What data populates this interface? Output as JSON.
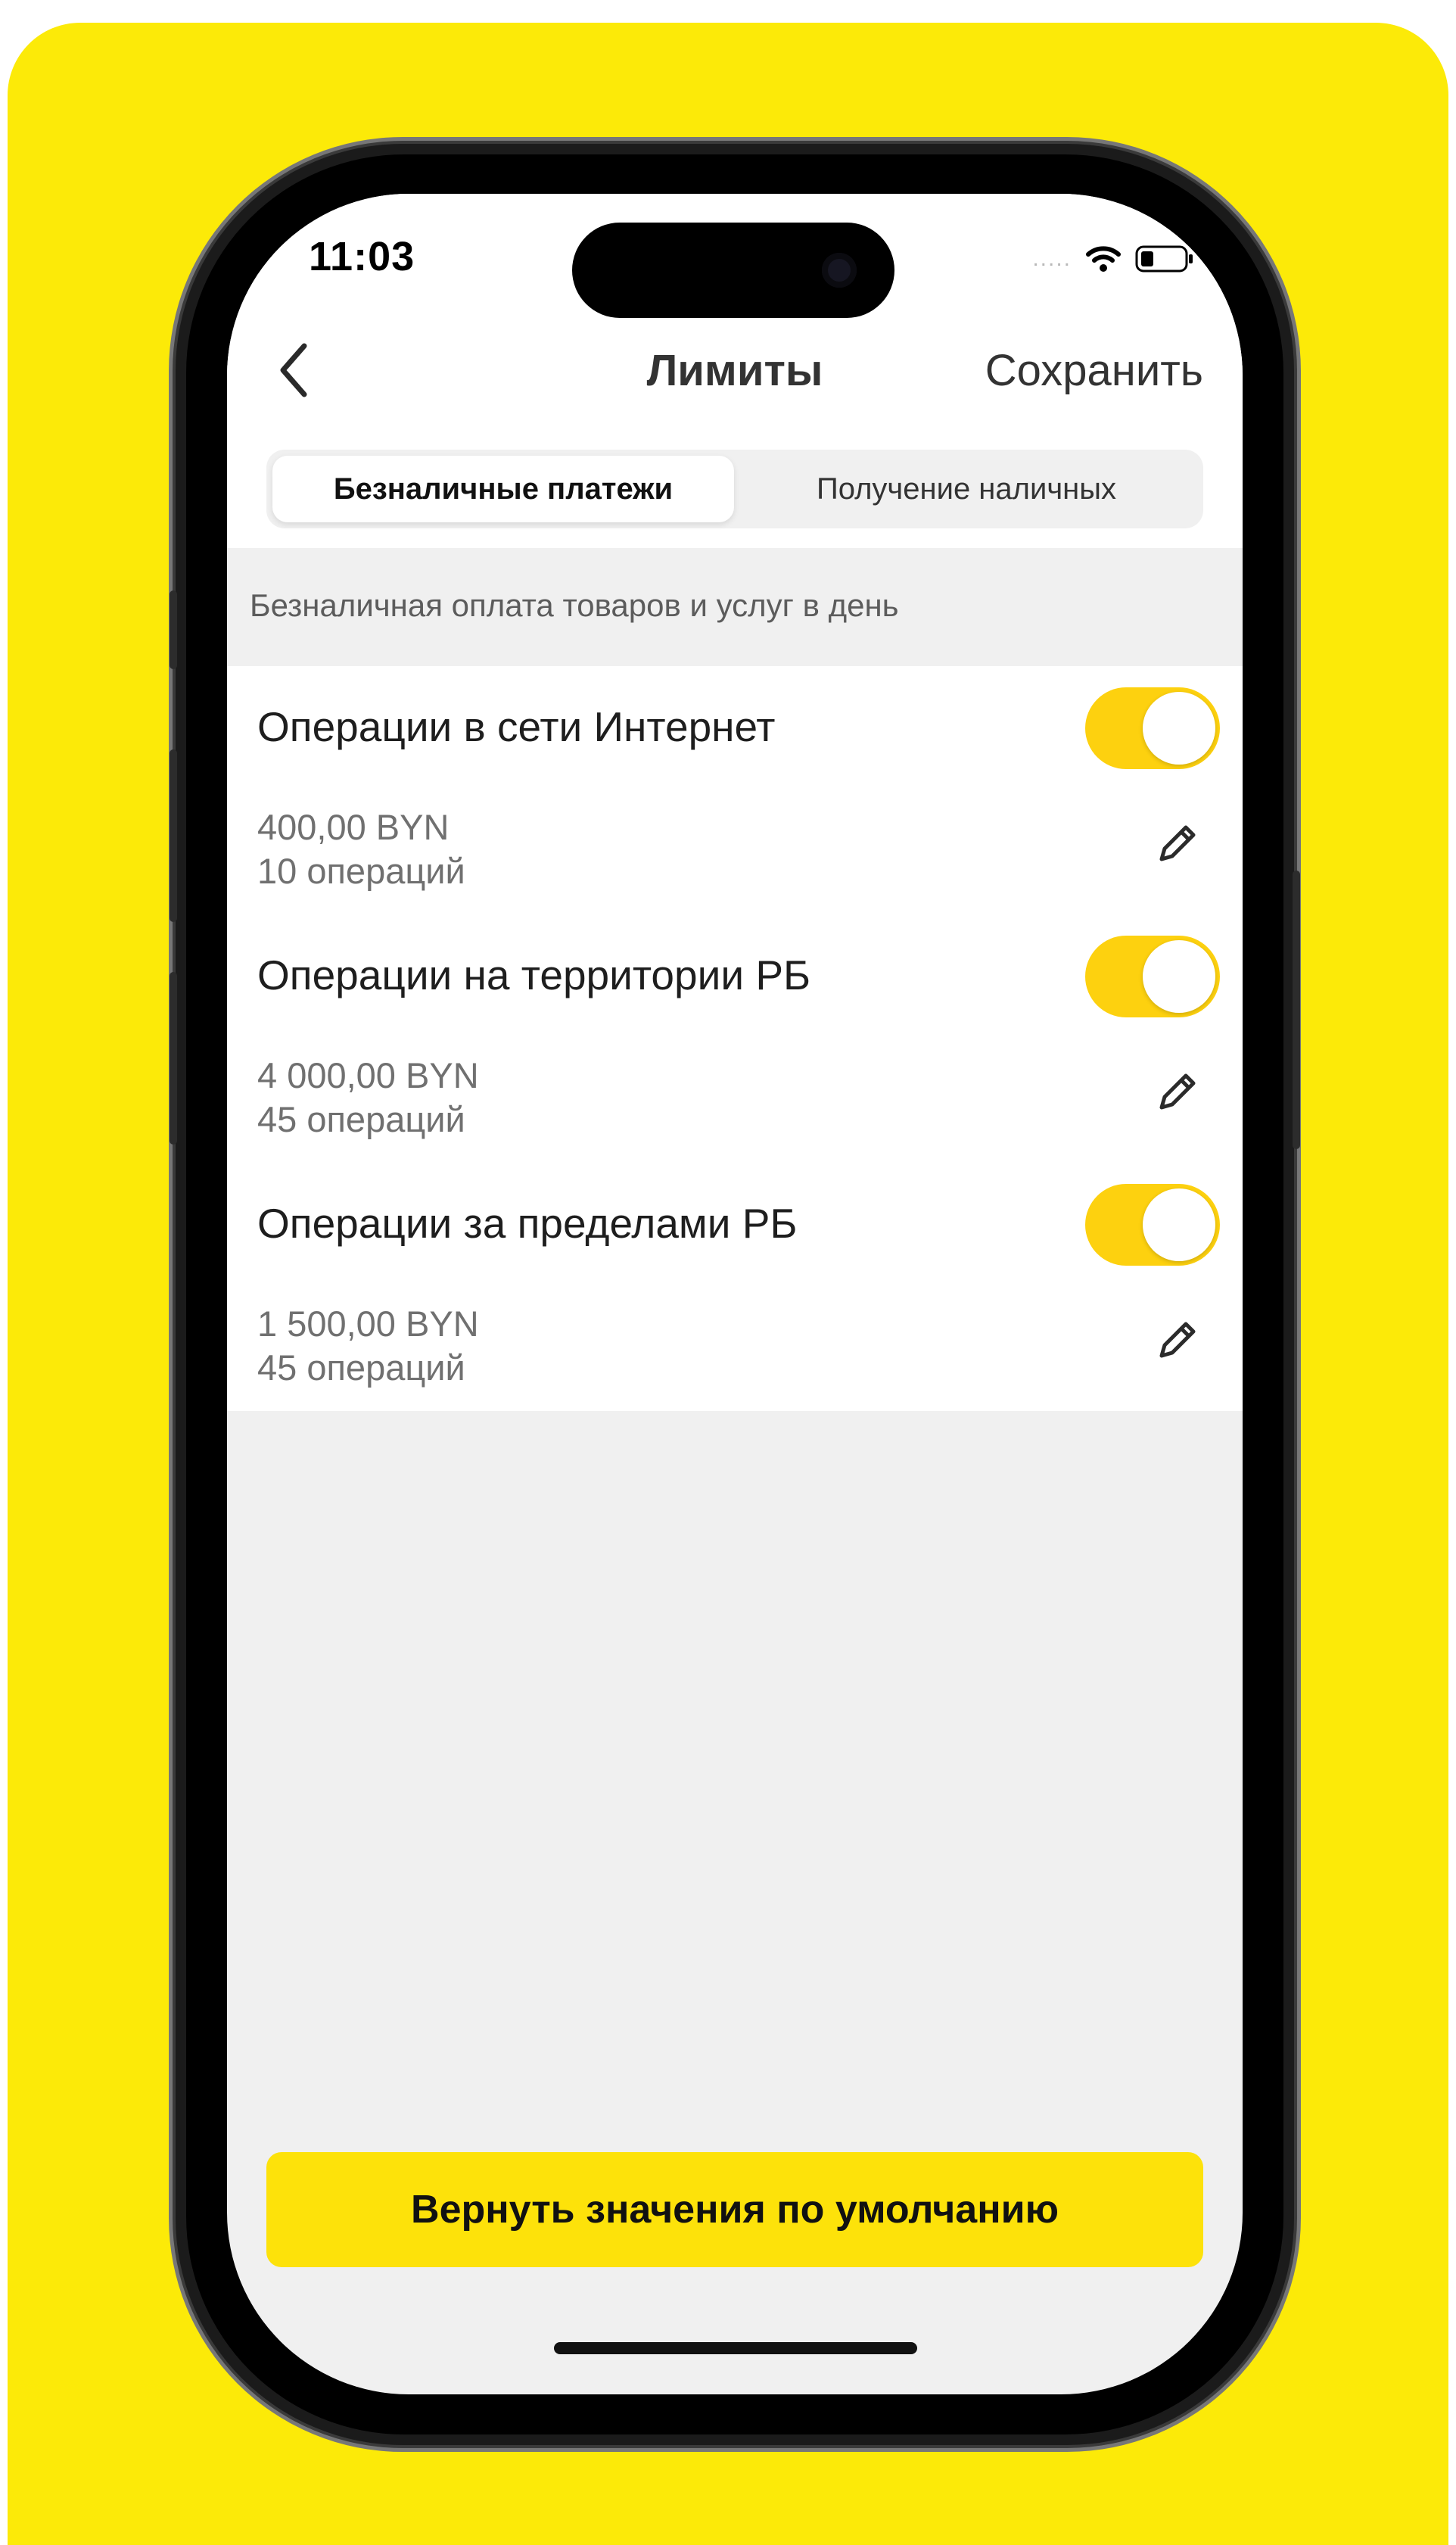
{
  "colors": {
    "background": "#fcea08",
    "accent": "#fdd10f",
    "button": "#fde20a",
    "screen_bg": "#f0f0f0"
  },
  "status_bar": {
    "time": "11:03",
    "signal": ".....",
    "icons": [
      "wifi-icon",
      "battery-icon"
    ]
  },
  "nav": {
    "back_icon": "chevron-left-icon",
    "title": "Лимиты",
    "save_label": "Сохранить"
  },
  "tabs": [
    {
      "label": "Безналичные платежи",
      "active": true
    },
    {
      "label": "Получение наличных",
      "active": false
    }
  ],
  "section": {
    "header": "Безналичная оплата товаров и услуг в день"
  },
  "limits": [
    {
      "title": "Операции в сети Интернет",
      "amount": "400,00 BYN",
      "count": "10 операций",
      "enabled": true,
      "edit_icon": "pencil-icon"
    },
    {
      "title": "Операции на территории РБ",
      "amount": "4 000,00 BYN",
      "count": "45 операций",
      "enabled": true,
      "edit_icon": "pencil-icon"
    },
    {
      "title": "Операции за пределами РБ",
      "amount": "1 500,00 BYN",
      "count": "45 операций",
      "enabled": true,
      "edit_icon": "pencil-icon"
    }
  ],
  "footer": {
    "reset_label": "Вернуть значения по умолчанию"
  }
}
